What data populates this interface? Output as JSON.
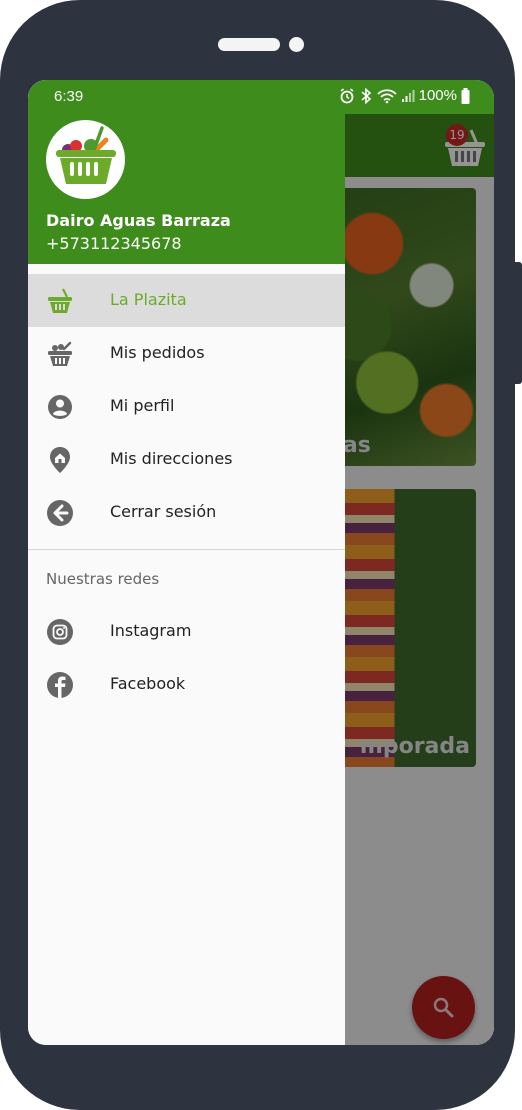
{
  "status_bar": {
    "time": "6:39",
    "battery": "100%"
  },
  "drawer": {
    "user_name": "Dairo Aguas Barraza",
    "user_phone": "+573112345678",
    "menu_items": [
      {
        "label": "La Plazita",
        "icon": "basket-icon",
        "active": true
      },
      {
        "label": "Mis pedidos",
        "icon": "grocery-basket-icon",
        "active": false
      },
      {
        "label": "Mi perfil",
        "icon": "account-circle-icon",
        "active": false
      },
      {
        "label": "Mis direcciones",
        "icon": "home-location-pin-icon",
        "active": false
      },
      {
        "label": "Cerrar sesión",
        "icon": "logout-arrow-icon",
        "active": false
      }
    ],
    "section_title": "Nuestras redes",
    "social_items": [
      {
        "label": "Instagram",
        "icon": "instagram-icon"
      },
      {
        "label": "Facebook",
        "icon": "facebook-icon"
      }
    ]
  },
  "background": {
    "cart_badge": "19",
    "card1_label": "ras",
    "card2_label": "mporada"
  },
  "colors": {
    "primary": "#3e8c1c",
    "active_text": "#6cab2a",
    "fab": "#b3201f"
  }
}
